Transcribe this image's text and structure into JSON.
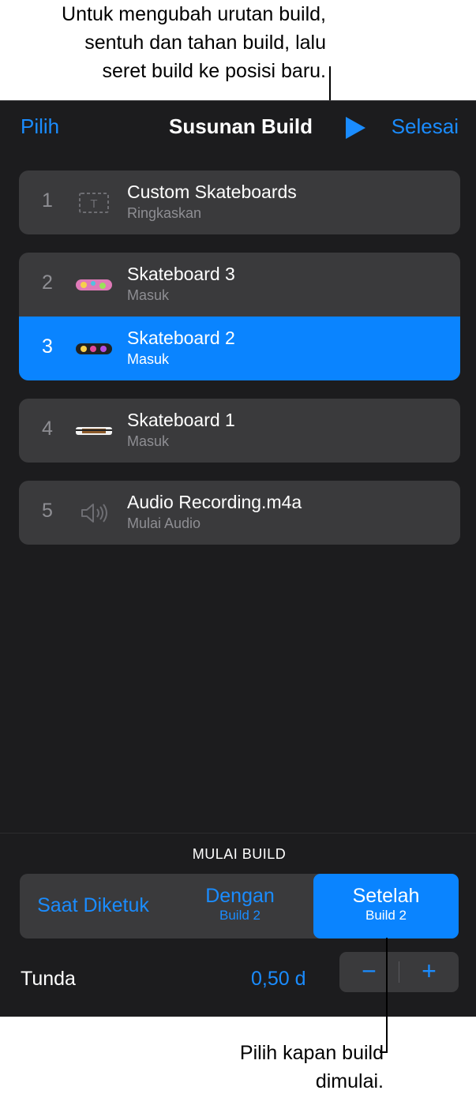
{
  "callouts": {
    "top": [
      "Untuk mengubah urutan build,",
      "sentuh dan tahan build, lalu",
      "seret build ke posisi baru."
    ],
    "bottom": [
      "Pilih kapan build",
      "dimulai."
    ]
  },
  "nav": {
    "left": "Pilih",
    "title": "Susunan Build",
    "play_icon": "play-icon",
    "right": "Selesai"
  },
  "builds": [
    {
      "number": "1",
      "title": "Custom Skateboards",
      "subtitle": "Ringkaskan",
      "icon": "text-box-icon"
    },
    {
      "number": "2",
      "title": "Skateboard 3",
      "subtitle": "Masuk",
      "icon": "skateboard-thumbnail"
    },
    {
      "number": "3",
      "title": "Skateboard 2",
      "subtitle": "Masuk",
      "icon": "skateboard-thumbnail",
      "selected": true
    },
    {
      "number": "4",
      "title": "Skateboard 1",
      "subtitle": "Masuk",
      "icon": "skateboard-thumbnail"
    },
    {
      "number": "5",
      "title": "Audio Recording.m4a",
      "subtitle": "Mulai Audio",
      "icon": "speaker-icon"
    }
  ],
  "start_build": {
    "section_label": "MULAI BUILD",
    "options": [
      {
        "label": "Saat Diketuk",
        "sub": ""
      },
      {
        "label": "Dengan",
        "sub": "Build 2"
      },
      {
        "label": "Setelah",
        "sub": "Build 2"
      }
    ],
    "selected": "Setelah"
  },
  "delay": {
    "label": "Tunda",
    "value": "0,50 d",
    "minus": "−",
    "plus": "+"
  },
  "colors": {
    "accent": "#0a84ff",
    "panel_bg": "#1c1c1e",
    "card_bg": "#3a3a3c"
  }
}
